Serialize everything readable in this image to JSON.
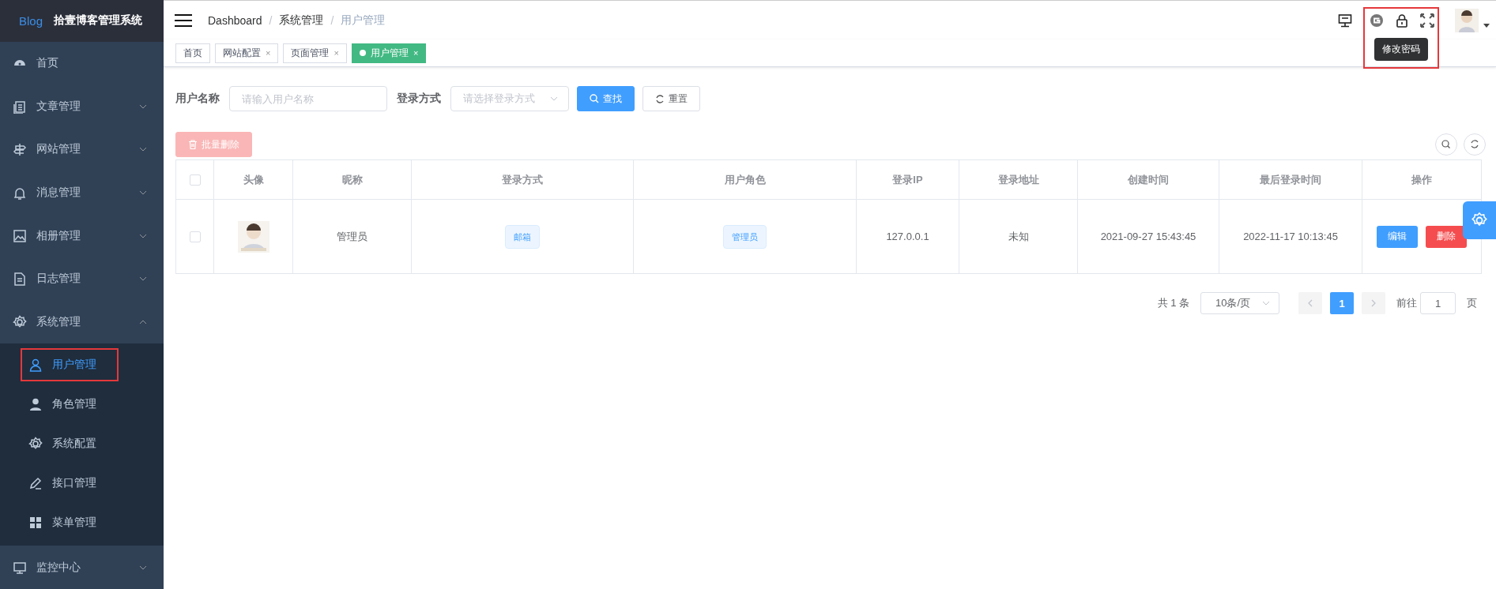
{
  "logo": {
    "mark": "Blog",
    "title": "拾壹博客管理系统"
  },
  "sidebar": {
    "items": [
      {
        "label": "首页",
        "has_children": false,
        "expanded": false
      },
      {
        "label": "文章管理",
        "has_children": true,
        "expanded": false
      },
      {
        "label": "网站管理",
        "has_children": true,
        "expanded": false
      },
      {
        "label": "消息管理",
        "has_children": true,
        "expanded": false
      },
      {
        "label": "相册管理",
        "has_children": true,
        "expanded": false
      },
      {
        "label": "日志管理",
        "has_children": true,
        "expanded": false
      },
      {
        "label": "系统管理",
        "has_children": true,
        "expanded": true,
        "children": [
          {
            "label": "用户管理",
            "selected": true,
            "highlighted": true
          },
          {
            "label": "角色管理",
            "selected": false,
            "highlighted": false
          },
          {
            "label": "系统配置",
            "selected": false,
            "highlighted": false
          },
          {
            "label": "接口管理",
            "selected": false,
            "highlighted": false
          },
          {
            "label": "菜单管理",
            "selected": false,
            "highlighted": false
          }
        ]
      },
      {
        "label": "监控中心",
        "has_children": true,
        "expanded": false
      }
    ]
  },
  "breadcrumb": [
    "Dashboard",
    "系统管理",
    "用户管理"
  ],
  "breadcrumb_separator": "/",
  "header": {
    "tools_highlighted": true,
    "tooltip": "修改密码"
  },
  "tags": [
    {
      "label": "首页",
      "closable": false,
      "selected": false
    },
    {
      "label": "网站配置",
      "closable": true,
      "selected": false
    },
    {
      "label": "页面管理",
      "closable": true,
      "selected": false
    },
    {
      "label": "用户管理",
      "closable": true,
      "selected": true
    }
  ],
  "close_glyph": "×",
  "filters": [
    {
      "label": "用户名称",
      "kind": "input",
      "placeholder": "请输入用户名称"
    },
    {
      "label": "登录方式",
      "kind": "select",
      "placeholder": "请选择登录方式"
    }
  ],
  "search_button": "查找",
  "reset_button": "重置",
  "batch_delete_button": {
    "label": "批量删除",
    "disabled": true
  },
  "table": {
    "select_all_checked": false,
    "columns": [
      "头像",
      "昵称",
      "登录方式",
      "用户角色",
      "登录IP",
      "登录地址",
      "创建时间",
      "最后登录时间",
      "操作"
    ],
    "rows": [
      {
        "checked": false,
        "nickname": "管理员",
        "login_type": "邮箱",
        "role": "管理员",
        "ip": "127.0.0.1",
        "address": "未知",
        "created": "2021-09-27 15:43:45",
        "last_login": "2022-11-17 10:13:45",
        "actions": [
          "编辑",
          "删除"
        ]
      }
    ]
  },
  "pagination": {
    "total": "共 1 条",
    "page_size": "10条/页",
    "pages": [
      {
        "label": "1",
        "selected": true
      }
    ],
    "goto_label": "前往",
    "goto_value": "1",
    "goto_suffix": "页"
  }
}
